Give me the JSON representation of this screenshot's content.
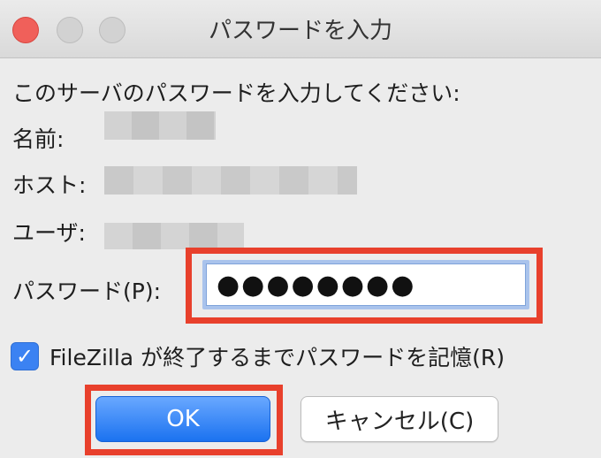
{
  "window": {
    "title": "パスワードを入力"
  },
  "dialog": {
    "prompt": "このサーバのパスワードを入力してください:",
    "name_label": "名前:",
    "host_label": "ホスト:",
    "user_label": "ユーザ:",
    "password_label": "パスワード(P):",
    "password_value": "●●●●●●●●",
    "remember_label": "FileZilla が終了するまでパスワードを記憶(R)",
    "remember_checked": true
  },
  "buttons": {
    "ok": "OK",
    "cancel": "キャンセル(C)"
  },
  "colors": {
    "highlight": "#e8402c",
    "accent": "#3b82f2",
    "close_light": "#f0605a"
  }
}
